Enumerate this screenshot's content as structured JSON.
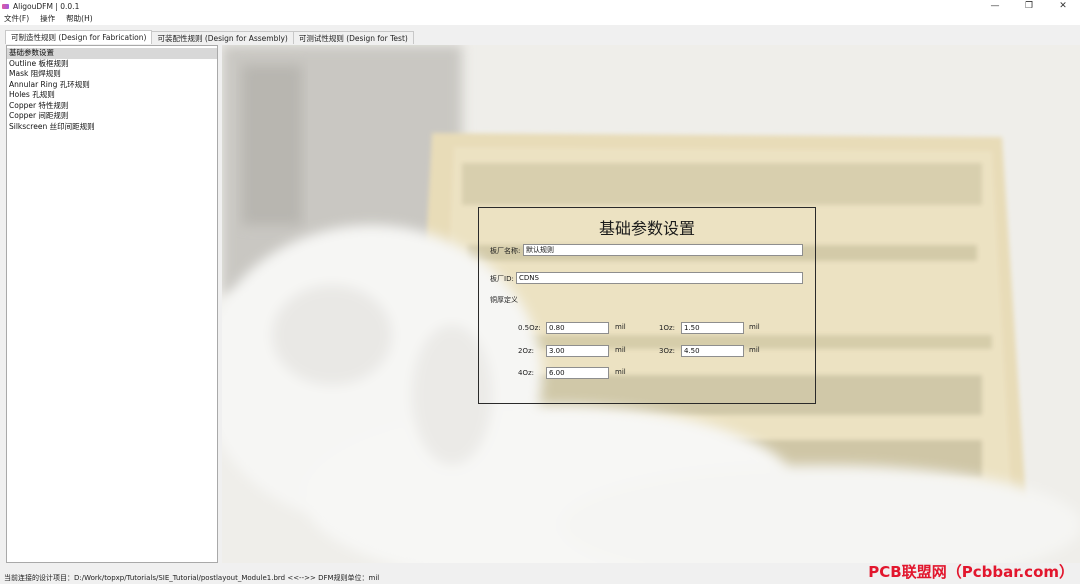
{
  "window": {
    "title": "AligouDFM | 0.0.1",
    "minimize_glyph": "—",
    "maximize_glyph": "❐",
    "close_glyph": "✕"
  },
  "menu": [
    "文件(F)",
    "操作",
    "帮助(H)"
  ],
  "tabs": [
    {
      "label": "可制造性规则 (Design for Fabrication)",
      "active": true
    },
    {
      "label": "可装配性规则 (Design for Assembly)",
      "active": false
    },
    {
      "label": "可测试性规则 (Design for Test)",
      "active": false
    }
  ],
  "tree": [
    {
      "label": "基础参数设置",
      "selected": true
    },
    {
      "label": "Outline 板框规则"
    },
    {
      "label": "Mask 阻焊规则"
    },
    {
      "label": "Annular Ring 孔环规则"
    },
    {
      "label": "Holes 孔规则"
    },
    {
      "label": "Copper 特性规则"
    },
    {
      "label": "Copper 间距规则"
    },
    {
      "label": "Silkscreen 丝印间距规则"
    }
  ],
  "panel": {
    "title": "基础参数设置",
    "factory_name_label": "板厂名称:",
    "factory_name_value": "默认规则",
    "factory_id_label": "板厂ID:",
    "factory_id_value": "CDNS",
    "copper_section_label": "铜厚定义",
    "copper": [
      {
        "label": "0.5Oz:",
        "value": "0.80",
        "unit": "mil"
      },
      {
        "label": "1Oz:",
        "value": "1.50",
        "unit": "mil"
      },
      {
        "label": "2Oz:",
        "value": "3.00",
        "unit": "mil"
      },
      {
        "label": "3Oz:",
        "value": "4.50",
        "unit": "mil"
      },
      {
        "label": "4Oz:",
        "value": "6.00",
        "unit": "mil"
      }
    ]
  },
  "status": {
    "text": "当前连接的设计项目：D:/Work/topxp/Tutorials/SIE_Tutorial/postlayout_Module1.brd <<-->> DFM规则单位：mil"
  },
  "watermark": "PCB联盟网（Pcbbar.com）"
}
